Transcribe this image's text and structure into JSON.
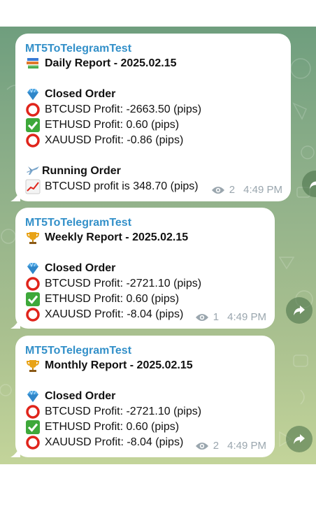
{
  "messages": [
    {
      "sender": "MT5ToTelegramTest",
      "title": "Daily Report - 2025.02.15",
      "closed_title": "Closed Order",
      "closed": [
        "BTCUSD Profit: -2663.50 (pips)",
        "ETHUSD Profit: 0.60 (pips)",
        "XAUUSD Profit: -0.86 (pips)"
      ],
      "running_title": "Running Order",
      "running": "BTCUSD profit is 348.70 (pips)",
      "views": "2",
      "time": "4:49 PM"
    },
    {
      "sender": "MT5ToTelegramTest",
      "title": "Weekly Report - 2025.02.15",
      "closed_title": "Closed Order",
      "closed": [
        "BTCUSD Profit: -2721.10 (pips)",
        "ETHUSD Profit: 0.60 (pips)",
        "XAUUSD Profit: -8.04 (pips)"
      ],
      "views": "1",
      "time": "4:49 PM"
    },
    {
      "sender": "MT5ToTelegramTest",
      "title": "Monthly Report - 2025.02.15",
      "closed_title": "Closed Order",
      "closed": [
        "BTCUSD Profit: -2721.10 (pips)",
        "ETHUSD Profit: 0.60 (pips)",
        "XAUUSD Profit: -8.04 (pips)"
      ],
      "views": "2",
      "time": "4:49 PM"
    }
  ],
  "icons": {
    "daily": "books-icon",
    "weekly": "trophy-icon",
    "monthly": "trophy-icon",
    "closed": "gem-icon",
    "loss": "red-circle-icon",
    "profit": "check-mark-icon",
    "running": "airplane-icon",
    "running_item": "chart-up-icon",
    "views": "eye-icon",
    "share": "share-icon"
  },
  "colors": {
    "sender": "#3390c9",
    "meta": "#9aa6ae",
    "loss": "#e0241b",
    "profit": "#3ea83a"
  }
}
